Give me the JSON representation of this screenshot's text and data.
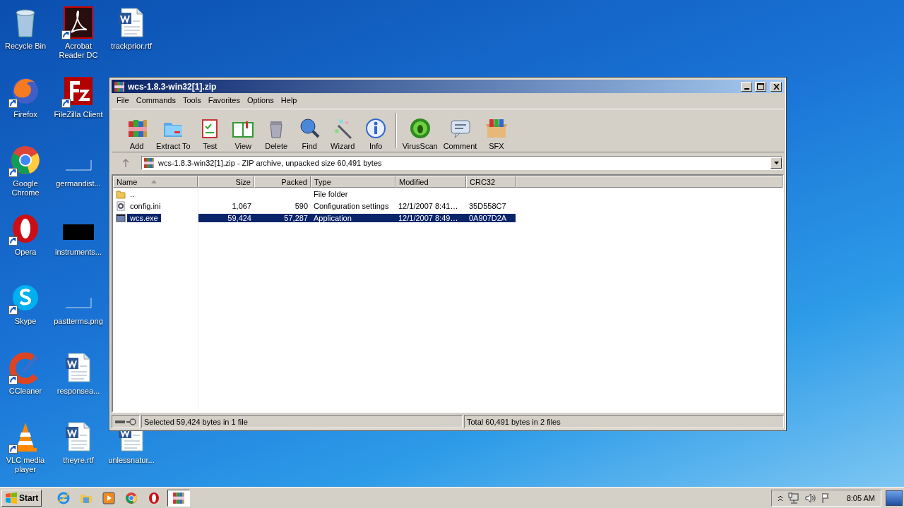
{
  "desktop_icons": [
    {
      "label": "Recycle Bin",
      "shortcut": false
    },
    {
      "label": "Acrobat Reader DC",
      "shortcut": true
    },
    {
      "label": "trackprior.rtf",
      "shortcut": false
    },
    {
      "label": "Firefox",
      "shortcut": true
    },
    {
      "label": "FileZilla Client",
      "shortcut": true
    },
    {
      "label": "Google Chrome",
      "shortcut": true
    },
    {
      "label": "germandist...",
      "shortcut": false
    },
    {
      "label": "Opera",
      "shortcut": true
    },
    {
      "label": "instruments...",
      "shortcut": false
    },
    {
      "label": "Skype",
      "shortcut": true
    },
    {
      "label": "pastterms.png",
      "shortcut": false
    },
    {
      "label": "CCleaner",
      "shortcut": true
    },
    {
      "label": "responsea...",
      "shortcut": false
    },
    {
      "label": "VLC media player",
      "shortcut": true
    },
    {
      "label": "theyre.rtf",
      "shortcut": false
    },
    {
      "label": "unlessnatur...",
      "shortcut": false
    }
  ],
  "window": {
    "title": "wcs-1.8.3-win32[1].zip",
    "menu": [
      "File",
      "Commands",
      "Tools",
      "Favorites",
      "Options",
      "Help"
    ],
    "toolbar": [
      "Add",
      "Extract To",
      "Test",
      "View",
      "Delete",
      "Find",
      "Wizard",
      "Info",
      "VirusScan",
      "Comment",
      "SFX"
    ],
    "address": "wcs-1.8.3-win32[1].zip - ZIP archive, unpacked size 60,491 bytes",
    "table": {
      "columns": [
        "Name",
        "Size",
        "Packed",
        "Type",
        "Modified",
        "CRC32"
      ],
      "rows": [
        {
          "kind": "folder",
          "selected": false,
          "cells": [
            "..",
            "",
            "",
            "File folder",
            "",
            ""
          ]
        },
        {
          "kind": "settings",
          "selected": false,
          "cells": [
            "config.ini",
            "1,067",
            "590",
            "Configuration settings",
            "12/1/2007 8:41…",
            "35D558C7"
          ]
        },
        {
          "kind": "application",
          "selected": true,
          "cells": [
            "wcs.exe",
            "59,424",
            "57,287",
            "Application",
            "12/1/2007 8:49…",
            "0A907D2A"
          ]
        }
      ]
    },
    "status_bar": [
      "Selected 59,424 bytes in 1 file",
      "Total 60,491 bytes in 2 files"
    ]
  },
  "taskbar": {
    "start": "Start",
    "clock": "8:05 AM"
  }
}
